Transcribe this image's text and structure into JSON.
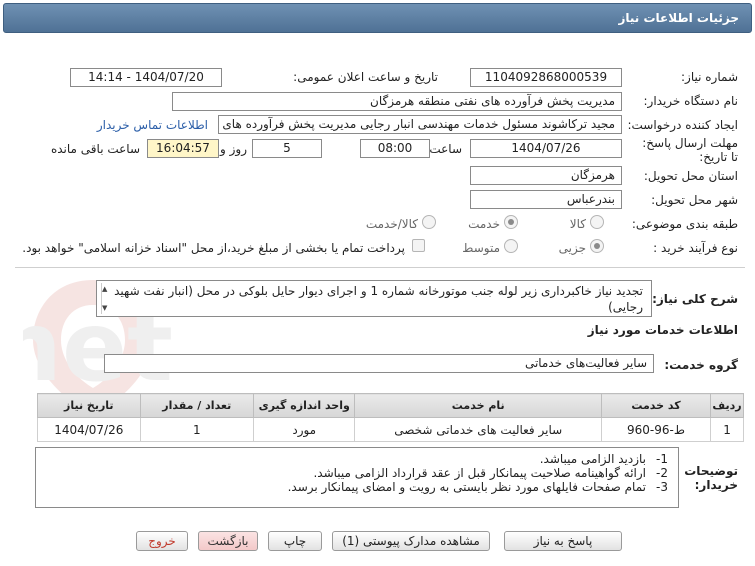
{
  "title": "جزئیات اطلاعات نیاز",
  "labels": {
    "need_number": "شماره نیاز:",
    "announce_datetime": "تاریخ و ساعت اعلان عمومی:",
    "buyer_org": "نام دستگاه خریدار:",
    "requester": "ایجاد کننده درخواست:",
    "deadline": "مهلت ارسال پاسخ: تا تاریخ:",
    "time": "ساعت",
    "day_and": "روز و",
    "hours_left": "ساعت باقی مانده",
    "province": "استان محل تحویل:",
    "city": "شهر محل تحویل:",
    "category": "طبقه بندی موضوعی:",
    "purchase_type": "نوع فرآیند خرید :",
    "general_desc": "شرح کلی نیاز:",
    "services_info": "اطلاعات خدمات مورد نیاز",
    "service_group": "گروه خدمت:",
    "buyer_notes": "توضیحات خریدار:"
  },
  "values": {
    "need_number": "1104092868000539",
    "announce_datetime": "1404/07/20 - 14:14",
    "buyer_org": "مدیریت پخش فرآورده های نفتی منطقه هرمزگان",
    "requester": "مجید ترکاشوند مسئول خدمات مهندسی انبار رجایی مدیریت پخش فرآورده های",
    "contact_link": "اطلاعات تماس خریدار",
    "deadline_date": "1404/07/26",
    "deadline_time": "08:00",
    "days_left": "5",
    "time_left": "16:04:57",
    "province": "هرمزگان",
    "city": "بندرعباس",
    "general_desc": "تجدید نیاز خاکبرداری زیر لوله جنب موتورخانه شماره 1 و اجرای دیوار حایل بلوکی در محل (انبار نفت شهید رجایی)",
    "service_group": "سایر فعالیت‌های خدماتی"
  },
  "category_options": [
    {
      "label": "کالا",
      "selected": false
    },
    {
      "label": "خدمت",
      "selected": true
    },
    {
      "label": "کالا/خدمت",
      "selected": false
    }
  ],
  "purchase_options": [
    {
      "label": "جزیی",
      "selected": true
    },
    {
      "label": "متوسط",
      "selected": false
    }
  ],
  "payment_note": "پرداخت تمام یا بخشی از مبلغ خرید،از محل \"اسناد خزانه اسلامی\" خواهد بود.",
  "table": {
    "headers": [
      "ردیف",
      "کد خدمت",
      "نام خدمت",
      "واحد اندازه گیری",
      "تعداد / مقدار",
      "تاریخ نیاز"
    ],
    "rows": [
      [
        "1",
        "ط-96-960",
        "سایر فعالیت های خدماتی شخصی",
        "مورد",
        "1",
        "1404/07/26"
      ]
    ]
  },
  "notes": [
    {
      "num": "1-",
      "text": "بازدید الزامی میباشد."
    },
    {
      "num": "2-",
      "text": "ارائه گواهینامه صلاحیت پیمانکار قبل از عقد قرارداد الزامی میباشد."
    },
    {
      "num": "3-",
      "text": "تمام صفحات فایلهای مورد نظر بایستی به رویت و امضای پیمانکار برسد."
    }
  ],
  "buttons": {
    "reply": "پاسخ به نیاز",
    "attachments": "مشاهده مدارک پیوستی (1)",
    "print": "چاپ",
    "back": "بازگشت",
    "exit": "خروج"
  },
  "watermark_text": "AriaTender.net",
  "colors": {
    "titlebar": "#5a7ca0",
    "link": "#2b5ea8",
    "time_left_bg": "#fff6c8"
  }
}
